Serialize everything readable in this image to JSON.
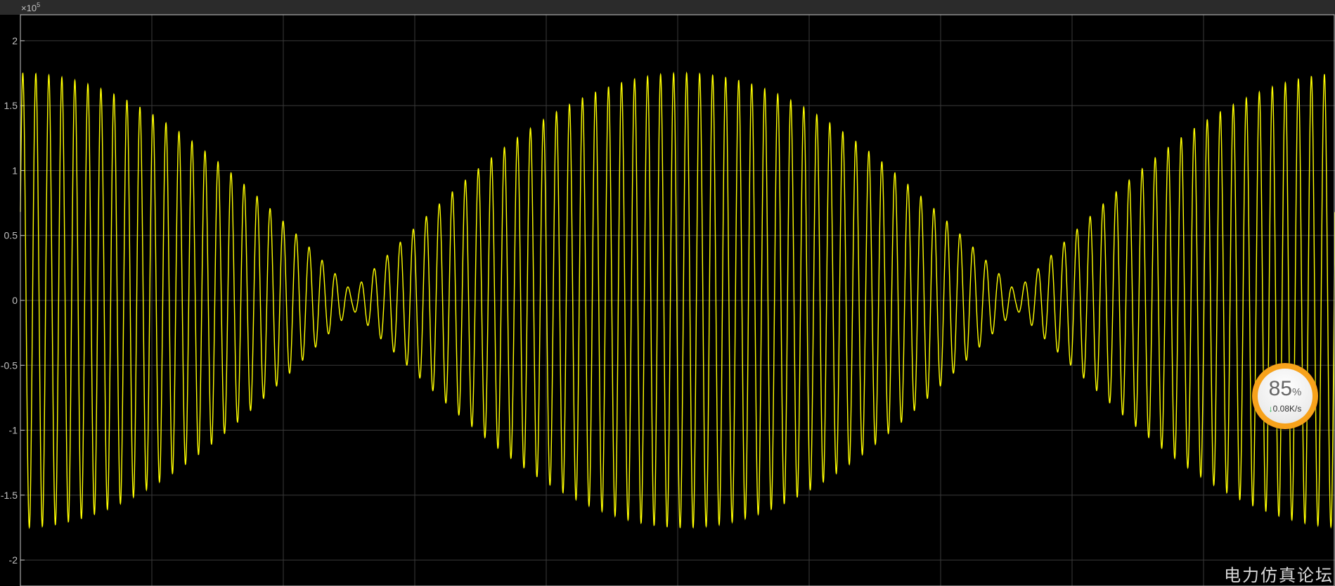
{
  "colors": {
    "background": "#000000",
    "grid": "#3a3a3a",
    "axis_border": "#c8c8c8",
    "tick_label": "#c0c0c0",
    "signal": "#ffff00",
    "widget_ring": "#f7a21b",
    "arrow": "#1bb24b"
  },
  "axis": {
    "y_exponent_label": "×10",
    "y_exponent_power": "5"
  },
  "chart_data": {
    "type": "line",
    "title": "",
    "xlabel": "",
    "ylabel": "",
    "x_ticks": [],
    "y_ticks": [
      2,
      1.5,
      1,
      0.5,
      0,
      -0.5,
      -1,
      -1.5,
      -2
    ],
    "y_tick_labels": [
      "2",
      "1.5",
      "1",
      "0.5",
      "0",
      "-0.5",
      "-1",
      "-1.5",
      "-2"
    ],
    "ylim": [
      -2.2,
      2.2
    ],
    "grid": true,
    "legend": "none",
    "series": [
      {
        "color": "#ffff00",
        "amplitude_peak": 1.75,
        "x_domain_cycles": 101,
        "carrier_cycles_across_view": 101,
        "envelope": "abs(cos)",
        "envelope_peaks_at_cycle": [
          0,
          51,
          101
        ],
        "envelope_nulls_at_cycle": [
          26,
          77
        ]
      }
    ]
  },
  "speed_widget": {
    "percent": "85",
    "percent_sign": "%",
    "arrow": "↓",
    "rate": "0.08K/s"
  },
  "watermark": "电力仿真论坛"
}
